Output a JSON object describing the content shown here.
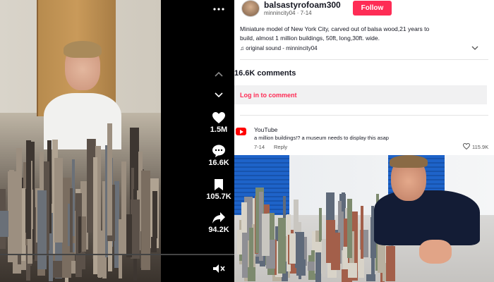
{
  "player": {
    "controls": {
      "up_icon": "chevron-up-icon",
      "down_icon": "chevron-down-icon",
      "like_count": "1.5M",
      "comment_count": "16.6K",
      "save_count": "105.7K",
      "share_count": "94.2K",
      "mute_icon": "speaker-muted-icon"
    },
    "more_icon": "more-dots-icon"
  },
  "post": {
    "username": "balsastyrofoam300",
    "handle": "minnincity04",
    "date": "7-14",
    "follow_label": "Follow",
    "caption": "Miniature model of New York City, carved out of balsa wood,21 years to build, almost 1 million buildings, 50ft, long,30ft. wide.",
    "sound": "♫ original sound - minnincity04",
    "comments_total": "16.6K comments",
    "login_prompt": "Log in to comment"
  },
  "comments": [
    {
      "author": "YouTube",
      "text": "a million buildings!? a museum needs to display this asap",
      "date": "7-14",
      "reply_label": "Reply",
      "likes": "115.9K"
    }
  ],
  "colors": {
    "accent": "#fe2c55",
    "youtube_red": "#ff0000",
    "player_bg": "#000000"
  }
}
